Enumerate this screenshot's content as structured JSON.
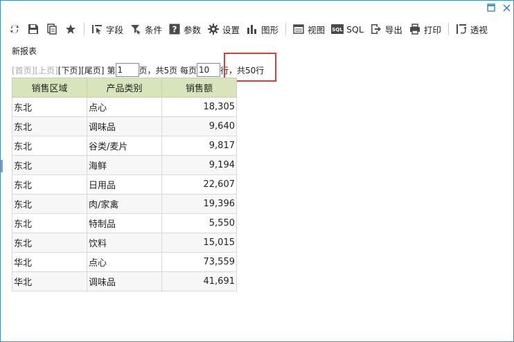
{
  "window": {
    "controls": [
      "maximize",
      "close"
    ]
  },
  "toolbar": {
    "items": [
      {
        "icon": "refresh-icon",
        "label": ""
      },
      {
        "icon": "save-icon",
        "label": ""
      },
      {
        "icon": "save-as-icon",
        "label": ""
      },
      {
        "icon": "star-icon",
        "label": ""
      },
      {
        "icon": "field-icon",
        "label": "字段"
      },
      {
        "icon": "filter-icon",
        "label": "条件"
      },
      {
        "icon": "param-icon",
        "label": "参数"
      },
      {
        "icon": "gear-icon",
        "label": "设置"
      },
      {
        "icon": "chart-icon",
        "label": "图形"
      },
      {
        "icon": "view-icon",
        "label": "视图"
      },
      {
        "icon": "sql-icon",
        "label": "SQL"
      },
      {
        "icon": "export-icon",
        "label": "导出"
      },
      {
        "icon": "print-icon",
        "label": "打印"
      },
      {
        "icon": "pivot-icon",
        "label": "透视"
      }
    ]
  },
  "report": {
    "title": "新报表"
  },
  "pager": {
    "first": "[首页]",
    "prev": "[上页]",
    "next": "[下页]",
    "last": "[尾页]",
    "page_prefix": "第",
    "page_value": "1",
    "page_suffix": "页，共5页 每页",
    "page_size_value": "10",
    "rows_suffix": "行，共50行"
  },
  "table": {
    "columns": [
      "销售区域",
      "产品类别",
      "销售额"
    ],
    "rows": [
      [
        "东北",
        "点心",
        "18,305"
      ],
      [
        "东北",
        "调味品",
        "9,640"
      ],
      [
        "东北",
        "谷类/麦片",
        "9,817"
      ],
      [
        "东北",
        "海鲜",
        "9,194"
      ],
      [
        "东北",
        "日用品",
        "22,607"
      ],
      [
        "东北",
        "肉/家禽",
        "19,396"
      ],
      [
        "东北",
        "特制品",
        "5,550"
      ],
      [
        "东北",
        "饮料",
        "15,015"
      ],
      [
        "华北",
        "点心",
        "73,559"
      ],
      [
        "华北",
        "调味品",
        "41,691"
      ]
    ]
  },
  "colors": {
    "header_bg": "#d8e4bc",
    "window_border": "#3c8fd6",
    "highlight": "#e23b3b"
  }
}
